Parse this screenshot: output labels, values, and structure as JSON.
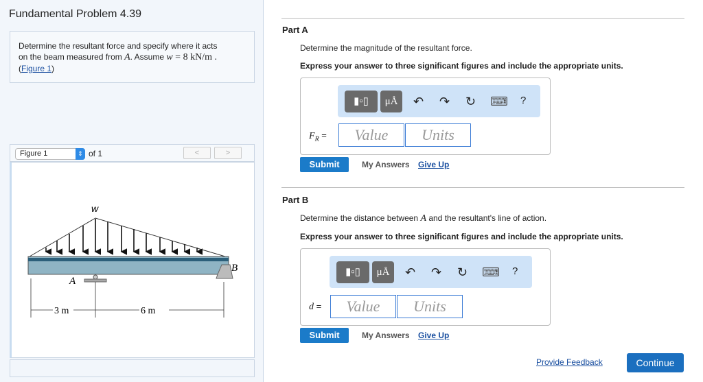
{
  "problem": {
    "title": "Fundamental Problem 4.39",
    "desc_1": "Determine the resultant force and specify where it acts",
    "desc_2a": "on the beam measured from ",
    "desc_A": "A",
    "desc_2b": ". Assume ",
    "desc_w": "w",
    "desc_eq": " = 8 kN/m .",
    "figure_link": "Figure 1"
  },
  "figure": {
    "select": "Figure 1",
    "of": "of 1",
    "prev": "<",
    "next": ">",
    "w_label": "w",
    "A_label": "A",
    "B_label": "B",
    "dim1": "3 m",
    "dim2": "6 m"
  },
  "toolbar": {
    "templates": "templates",
    "symbols": "μÅ",
    "undo": "↶",
    "redo": "↷",
    "reset": "↻",
    "keyboard": "⌨",
    "help": "?"
  },
  "partA": {
    "title": "Part A",
    "question": "Determine the magnitude of the resultant force.",
    "instr": "Express your answer to three significant figures and include the appropriate units.",
    "var": "F",
    "sub": "R",
    "eq": " =",
    "value_ph": "Value",
    "units_ph": "Units",
    "submit": "Submit",
    "my_answers": "My Answers",
    "give_up": "Give Up"
  },
  "partB": {
    "title": "Part B",
    "question_a": "Determine the distance between ",
    "question_A": "A",
    "question_b": " and the resultant's line of action.",
    "instr": "Express your answer to three significant figures and include the appropriate units.",
    "var": "d",
    "eq": " =",
    "value_ph": "Value",
    "units_ph": "Units",
    "submit": "Submit",
    "my_answers": "My Answers",
    "give_up": "Give Up"
  },
  "footer": {
    "feedback": "Provide Feedback",
    "continue": "Continue"
  }
}
